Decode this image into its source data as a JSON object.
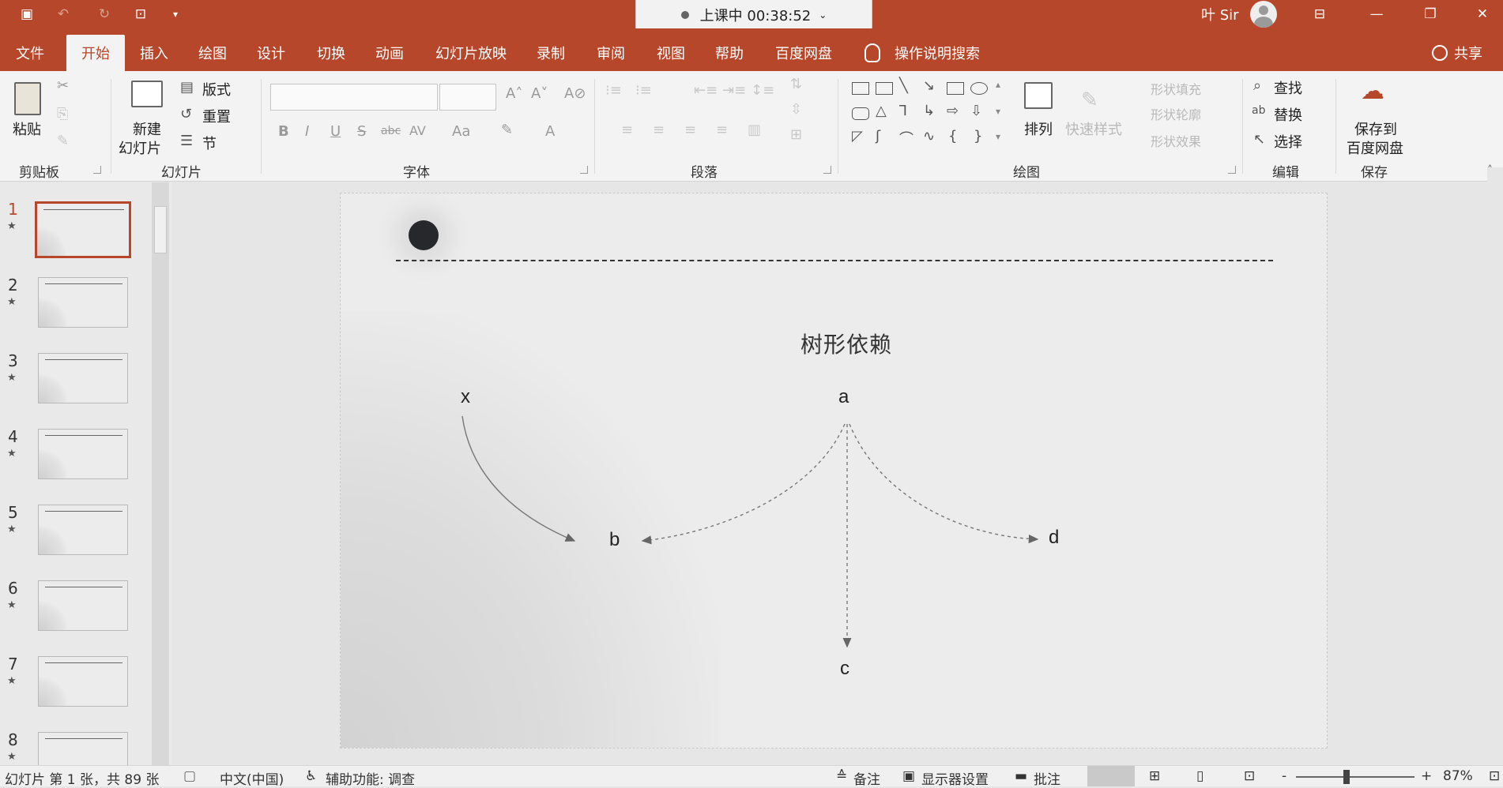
{
  "recording": {
    "label": "上课中 00:38:52"
  },
  "user": {
    "name": "叶 Sir"
  },
  "menu": {
    "tabs": [
      "文件",
      "开始",
      "插入",
      "绘图",
      "设计",
      "切换",
      "动画",
      "幻灯片放映",
      "录制",
      "审阅",
      "视图",
      "帮助",
      "百度网盘"
    ],
    "active": "开始",
    "search_label": "操作说明搜索",
    "share_label": "共享"
  },
  "ribbon": {
    "paste": "粘贴",
    "new_slide_line1": "新建",
    "new_slide_line2": "幻灯片",
    "layout": "版式",
    "reset": "重置",
    "section": "节",
    "arrange": "排列",
    "quick_styles": "快速样式",
    "shape_fill": "形状填充",
    "shape_outline": "形状轮廓",
    "shape_effects": "形状效果",
    "find": "查找",
    "replace": "替换",
    "select": "选择",
    "save_to_line1": "保存到",
    "save_to_line2": "百度网盘",
    "groups": {
      "clipboard": "剪贴板",
      "slides": "幻灯片",
      "font": "字体",
      "paragraph": "段落",
      "drawing": "绘图",
      "editing": "编辑",
      "save": "保存"
    },
    "font_buttons": [
      "B",
      "I",
      "U",
      "S",
      "abc",
      "AV",
      "Aa",
      "A"
    ]
  },
  "thumbnails": [
    {
      "num": "1",
      "star": "★"
    },
    {
      "num": "2",
      "star": "★"
    },
    {
      "num": "3",
      "star": "★"
    },
    {
      "num": "4",
      "star": "★"
    },
    {
      "num": "5",
      "star": "★"
    },
    {
      "num": "6",
      "star": "★"
    },
    {
      "num": "7",
      "star": "★"
    },
    {
      "num": "8",
      "star": "★"
    }
  ],
  "slide": {
    "title": "树形依赖",
    "nodes": {
      "x": "x",
      "a": "a",
      "b": "b",
      "c": "c",
      "d": "d"
    }
  },
  "status": {
    "slide_info": "幻灯片 第 1 张，共 89 张",
    "language": "中文(中国)",
    "accessibility": "辅助功能: 调查",
    "notes": "备注",
    "display_settings": "显示器设置",
    "comments": "批注",
    "zoom_minus": "-",
    "zoom_plus": "+",
    "zoom_level": "87%"
  },
  "colors": {
    "accent": "#b7472a",
    "ribbon_bg": "#f3f3f3",
    "slide_bg": "#ececec"
  }
}
